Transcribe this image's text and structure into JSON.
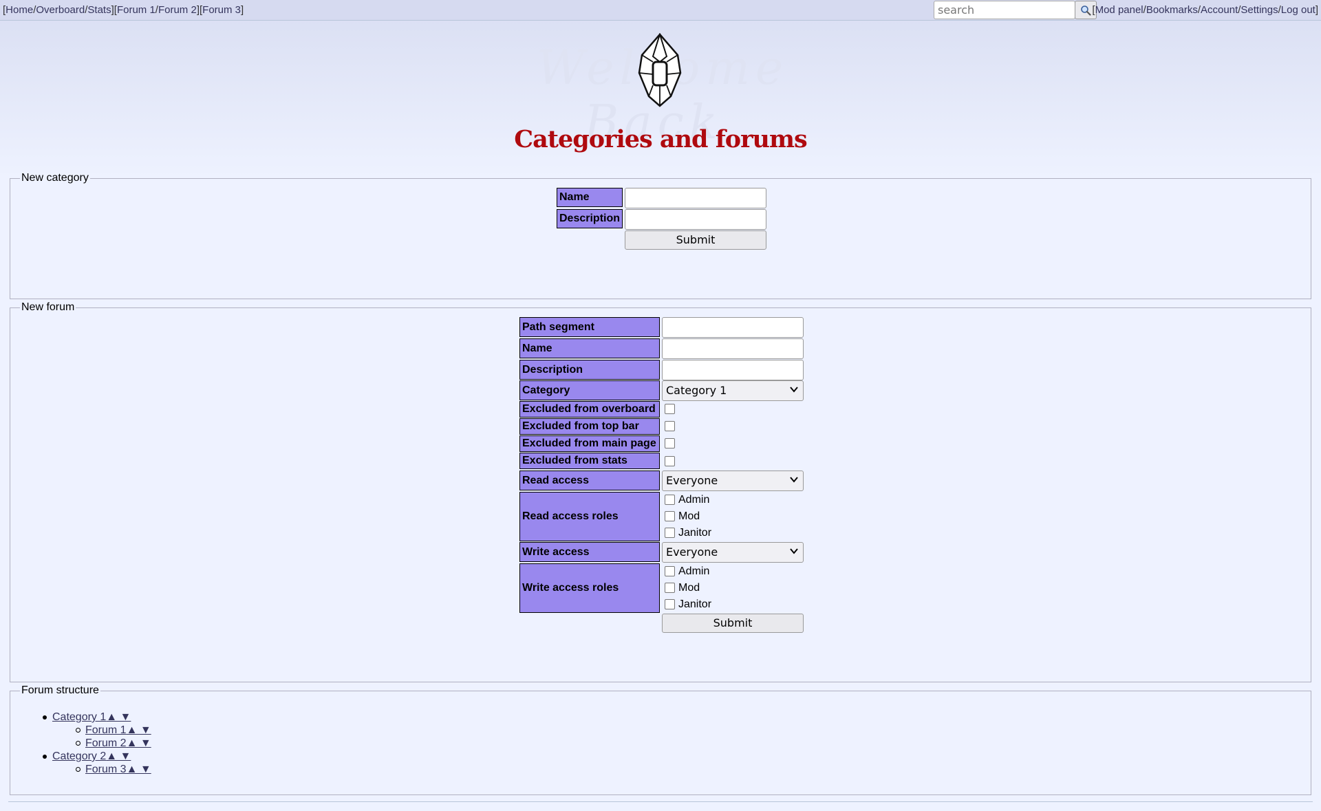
{
  "nav": {
    "group1": [
      "Home",
      "Overboard",
      "Stats"
    ],
    "group2": [
      "Forum 1",
      "Forum 2"
    ],
    "group3": [
      "Forum 3"
    ],
    "right": [
      "Mod panel",
      "Bookmarks",
      "Account",
      "Settings",
      "Log out"
    ],
    "search_placeholder": "search"
  },
  "banner": {
    "text": "Welcome Back"
  },
  "page_title": "Categories and forums",
  "new_category": {
    "legend": "New category",
    "name_label": "Name",
    "description_label": "Description",
    "submit": "Submit"
  },
  "new_forum": {
    "legend": "New forum",
    "path_label": "Path segment",
    "name_label": "Name",
    "description_label": "Description",
    "category_label": "Category",
    "category_value": "Category 1",
    "excl_overboard_label": "Excluded from overboard",
    "excl_topbar_label": "Excluded from top bar",
    "excl_main_label": "Excluded from main page",
    "excl_stats_label": "Excluded from stats",
    "read_access_label": "Read access",
    "read_access_value": "Everyone",
    "read_roles_label": "Read access roles",
    "write_access_label": "Write access",
    "write_access_value": "Everyone",
    "write_roles_label": "Write access roles",
    "roles": [
      "Admin",
      "Mod",
      "Janitor"
    ],
    "submit": "Submit"
  },
  "structure": {
    "legend": "Forum structure",
    "arrows": "▲ ▼",
    "categories": [
      {
        "name": "Category 1",
        "forums": [
          "Forum 1",
          "Forum 2"
        ]
      },
      {
        "name": "Category 2",
        "forums": [
          "Forum 3"
        ]
      }
    ]
  }
}
